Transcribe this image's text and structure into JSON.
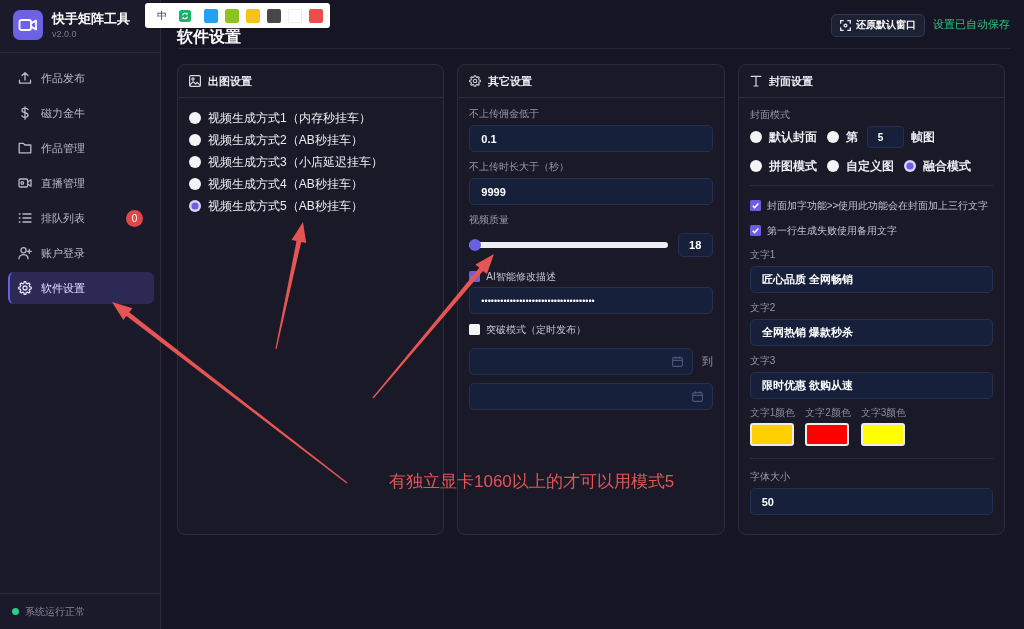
{
  "app": {
    "title": "快手矩阵工具",
    "version": "v2.0.0"
  },
  "sidebar": {
    "items": [
      {
        "label": "作品发布",
        "selected": false
      },
      {
        "label": "磁力金牛",
        "selected": false
      },
      {
        "label": "作品管理",
        "selected": false
      },
      {
        "label": "直播管理",
        "selected": false
      },
      {
        "label": "排队列表",
        "selected": false,
        "badge": "0"
      },
      {
        "label": "账户登录",
        "selected": false
      },
      {
        "label": "软件设置",
        "selected": true
      }
    ],
    "status": "系统运行正常"
  },
  "header": {
    "title": "软件设置",
    "restore_button": "还原默认窗口",
    "save_status": "设置已自动保存"
  },
  "output_settings": {
    "title": "出图设置",
    "options": [
      {
        "label": "视频生成方式1（内存秒挂车）",
        "selected": false
      },
      {
        "label": "视频生成方式2（AB秒挂车）",
        "selected": false
      },
      {
        "label": "视频生成方式3（小店延迟挂车）",
        "selected": false
      },
      {
        "label": "视频生成方式4（AB秒挂车）",
        "selected": false
      },
      {
        "label": "视频生成方式5（AB秒挂车）",
        "selected": true
      }
    ]
  },
  "other_settings": {
    "title": "其它设置",
    "min_commission": {
      "label": "不上传佣金低于",
      "value": "0.1"
    },
    "max_duration": {
      "label": "不上传时长大于（秒）",
      "value": "9999"
    },
    "quality": {
      "label": "视频质量",
      "level": 0,
      "reading": "18"
    },
    "ai_rewrite": {
      "label": "AI智能修改描述",
      "checked": true,
      "value": "••••••••••••••••••••••••••••••••••••"
    },
    "breakthrough": {
      "label": "突破模式（定时发布）",
      "checked": false,
      "range_separator": "到"
    }
  },
  "cover_settings": {
    "title": "封面设置",
    "mode_label": "封面模式",
    "mode_rows": [
      {
        "options": [
          {
            "kind": "plain",
            "label": "默认封面",
            "selected": false
          },
          {
            "kind": "frame",
            "label": "第",
            "selected": false,
            "value": "5",
            "suffix": "帧图"
          }
        ]
      },
      {
        "options": [
          {
            "kind": "plain",
            "label": "拼图模式",
            "selected": false
          },
          {
            "kind": "plain",
            "label": "自定义图",
            "selected": false
          },
          {
            "kind": "plain",
            "label": "融合模式",
            "selected": true
          }
        ]
      }
    ],
    "checkboxes": [
      {
        "label": "封面加字功能>>使用此功能会在封面加上三行文字",
        "checked": true
      },
      {
        "label": "第一行生成失败使用备用文字",
        "checked": true
      }
    ],
    "texts": [
      {
        "label": "文字1",
        "value": "匠心品质 全网畅销"
      },
      {
        "label": "文字2",
        "value": "全网热销 爆款秒杀"
      },
      {
        "label": "文字3",
        "value": "限时优惠 欲购从速"
      }
    ],
    "colors": [
      {
        "label": "文字1颜色",
        "color": "#ffd000"
      },
      {
        "label": "文字2颜色",
        "color": "#ff0000"
      },
      {
        "label": "文字3颜色",
        "color": "#ffff00"
      }
    ],
    "font_size": {
      "label": "字体大小",
      "value": "50"
    }
  },
  "annotation_toolbar": {
    "size": "中",
    "colors": [
      {
        "color": "#23a0ef"
      },
      {
        "color": "#8dc21f"
      },
      {
        "color": "#f7c21a"
      },
      {
        "color": "#474747"
      },
      {
        "color": "#ffffff"
      },
      {
        "color": "#eb4d4b"
      }
    ]
  },
  "annotation": {
    "text": "有独立显卡1060以上的才可以用模式5"
  }
}
